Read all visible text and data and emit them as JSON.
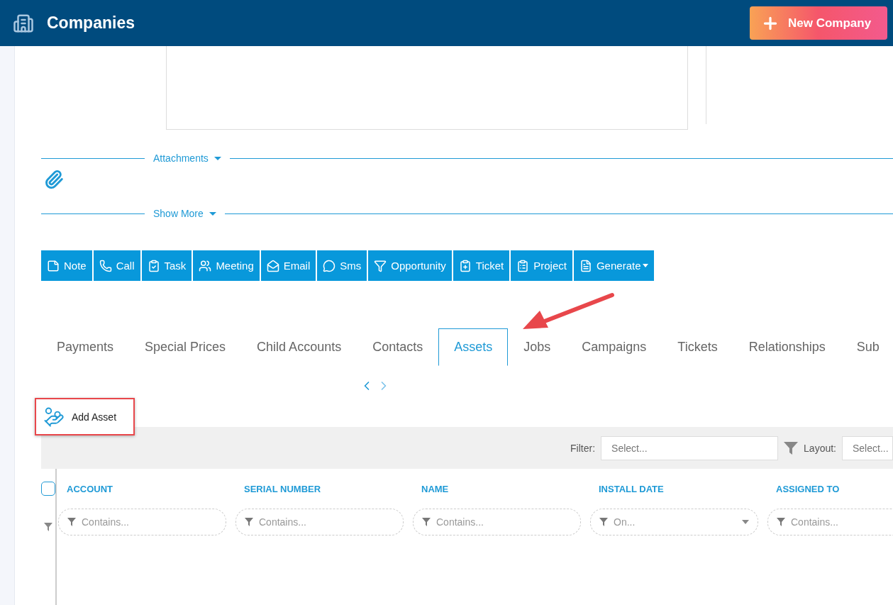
{
  "header": {
    "title": "Companies",
    "new_button": "New Company"
  },
  "sections": [
    {
      "label": "Attachments",
      "kind": "attachments"
    },
    {
      "label": "Show More",
      "kind": "plain"
    }
  ],
  "actions": [
    {
      "label": "Note",
      "dropdown": false
    },
    {
      "label": "Call",
      "dropdown": false
    },
    {
      "label": "Task",
      "dropdown": false
    },
    {
      "label": "Meeting",
      "dropdown": false
    },
    {
      "label": "Email",
      "dropdown": false
    },
    {
      "label": "Sms",
      "dropdown": false
    },
    {
      "label": "Opportunity",
      "dropdown": false
    },
    {
      "label": "Ticket",
      "dropdown": false
    },
    {
      "label": "Project",
      "dropdown": false
    },
    {
      "label": "Generate",
      "dropdown": true
    }
  ],
  "tabs": [
    {
      "label": "Payments",
      "selected": false
    },
    {
      "label": "Special Prices",
      "selected": false
    },
    {
      "label": "Child Accounts",
      "selected": false
    },
    {
      "label": "Contacts",
      "selected": false
    },
    {
      "label": "Assets",
      "selected": true
    },
    {
      "label": "Jobs",
      "selected": false
    },
    {
      "label": "Campaigns",
      "selected": false
    },
    {
      "label": "Tickets",
      "selected": false
    },
    {
      "label": "Relationships",
      "selected": false
    },
    {
      "label": "Sub",
      "selected": false
    }
  ],
  "add_button": "Add Asset",
  "toolbar": {
    "filter_label": "Filter:",
    "filter_placeholder": "Select...",
    "layout_label": "Layout:",
    "layout_placeholder": "Select..."
  },
  "table": {
    "select_all_checked": false,
    "columns": [
      {
        "title": "ACCOUNT",
        "kind": "text",
        "placeholder": "Contains..."
      },
      {
        "title": "SERIAL NUMBER",
        "kind": "text",
        "placeholder": "Contains..."
      },
      {
        "title": "NAME",
        "kind": "text",
        "placeholder": "Contains..."
      },
      {
        "title": "INSTALL DATE",
        "kind": "date",
        "placeholder": "On..."
      },
      {
        "title": "ASSIGNED TO",
        "kind": "text",
        "placeholder": "Contains..."
      }
    ]
  }
}
